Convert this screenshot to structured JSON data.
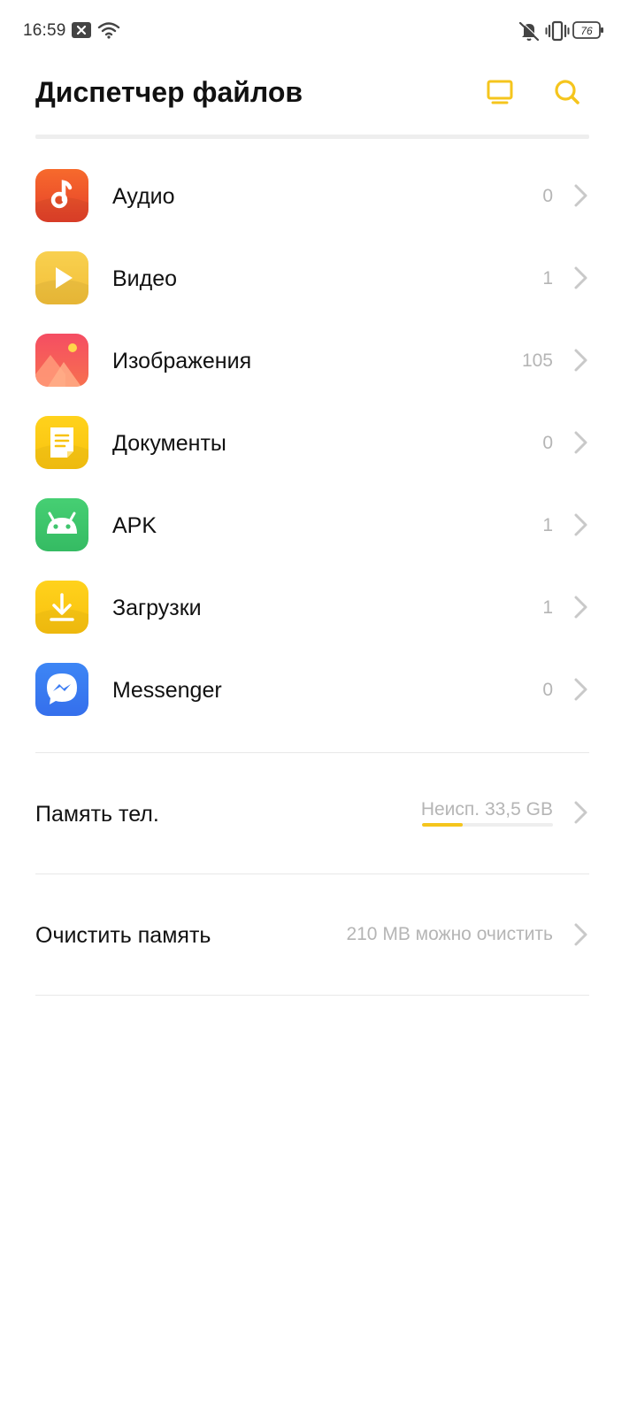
{
  "status_bar": {
    "time": "16:59",
    "battery_level": "76",
    "icons": [
      "notification-close-icon",
      "wifi-icon",
      "mute-icon",
      "vibrate-icon",
      "battery-icon"
    ]
  },
  "header": {
    "title": "Диспетчер файлов",
    "actions": [
      "remote-computer-icon",
      "search-icon"
    ],
    "accent_color": "#f5c51d"
  },
  "categories": [
    {
      "label": "Аудио",
      "count": "0",
      "icon": "music-note-icon",
      "color": "#f0552a"
    },
    {
      "label": "Видео",
      "count": "1",
      "icon": "play-icon",
      "color": "#f6c943"
    },
    {
      "label": "Изображения",
      "count": "105",
      "icon": "image-icon",
      "color": "#f5565f"
    },
    {
      "label": "Документы",
      "count": "0",
      "icon": "document-icon",
      "color": "#fccc14"
    },
    {
      "label": "APK",
      "count": "1",
      "icon": "android-icon",
      "color": "#3fc56d"
    },
    {
      "label": "Загрузки",
      "count": "1",
      "icon": "download-icon",
      "color": "#fcc813"
    },
    {
      "label": "Messenger",
      "count": "0",
      "icon": "messenger-icon",
      "color": "#3a7bf2"
    }
  ],
  "storage": {
    "label": "Память тел.",
    "value": "Неисп. 33,5 GB",
    "used_fraction": 0.31
  },
  "cleanup": {
    "label": "Очистить память",
    "value": "210 MB можно очистить"
  }
}
